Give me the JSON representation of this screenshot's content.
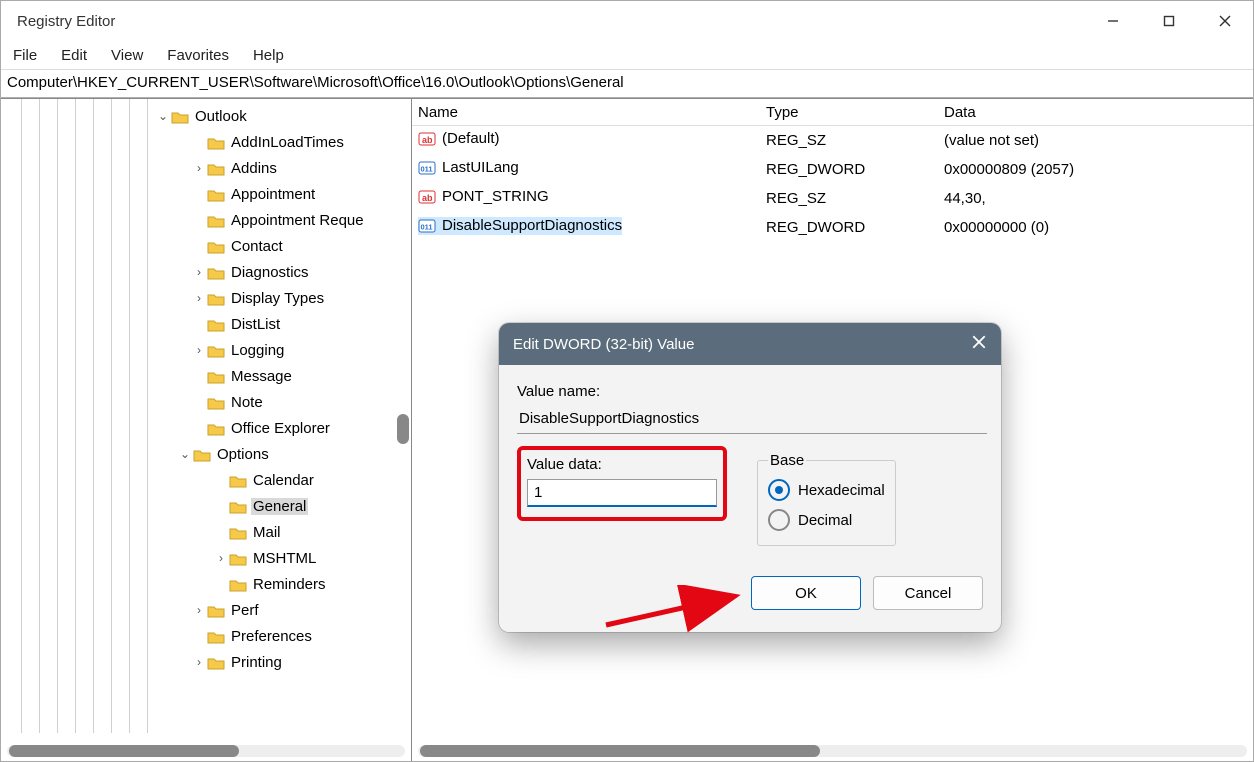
{
  "window": {
    "title": "Registry Editor"
  },
  "menu": {
    "file": "File",
    "edit": "Edit",
    "view": "View",
    "favorites": "Favorites",
    "help": "Help"
  },
  "address": "Computer\\HKEY_CURRENT_USER\\Software\\Microsoft\\Office\\16.0\\Outlook\\Options\\General",
  "tree": {
    "outlook": "Outlook",
    "addinloadtimes": "AddInLoadTimes",
    "addins": "Addins",
    "appointment": "Appointment",
    "appointmentreq": "Appointment Reque",
    "contact": "Contact",
    "diagnostics": "Diagnostics",
    "displaytypes": "Display Types",
    "distlist": "DistList",
    "logging": "Logging",
    "message": "Message",
    "note": "Note",
    "officeexplorer": "Office Explorer",
    "options": "Options",
    "calendar": "Calendar",
    "general": "General",
    "mail": "Mail",
    "mshtml": "MSHTML",
    "reminders": "Reminders",
    "perf": "Perf",
    "preferences": "Preferences",
    "printing": "Printing"
  },
  "list": {
    "header": {
      "name": "Name",
      "type": "Type",
      "data": "Data"
    },
    "rows": [
      {
        "name": "(Default)",
        "type": "REG_SZ",
        "data": "(value not set)",
        "kind": "sz"
      },
      {
        "name": "LastUILang",
        "type": "REG_DWORD",
        "data": "0x00000809 (2057)",
        "kind": "dw"
      },
      {
        "name": "PONT_STRING",
        "type": "REG_SZ",
        "data": "44,30,",
        "kind": "sz"
      },
      {
        "name": "DisableSupportDiagnostics",
        "type": "REG_DWORD",
        "data": "0x00000000 (0)",
        "kind": "dw",
        "selected": true
      }
    ]
  },
  "dialog": {
    "title": "Edit DWORD (32-bit) Value",
    "value_name_label": "Value name:",
    "value_name": "DisableSupportDiagnostics",
    "value_data_label": "Value data:",
    "value_data": "1",
    "base_label": "Base",
    "hex": "Hexadecimal",
    "dec": "Decimal",
    "ok": "OK",
    "cancel": "Cancel"
  }
}
